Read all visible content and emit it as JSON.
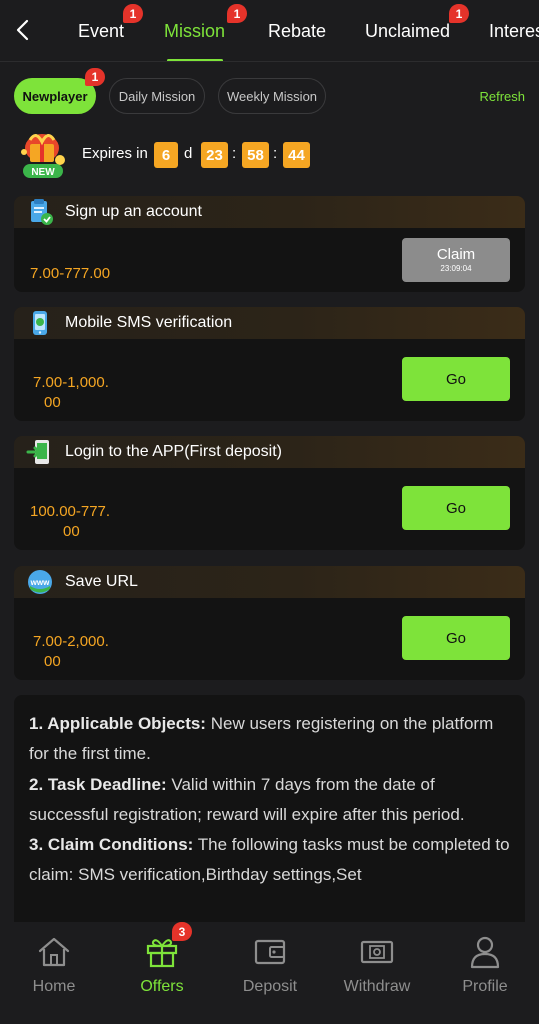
{
  "top_tabs": [
    {
      "label": "Event",
      "badge": "1"
    },
    {
      "label": "Mission",
      "badge": "1",
      "active": true
    },
    {
      "label": "Rebate",
      "badge": ""
    },
    {
      "label": "Unclaimed",
      "badge": "1"
    },
    {
      "label": "Interes",
      "badge": ""
    }
  ],
  "sub_tabs": [
    {
      "label": "Newplayer",
      "badge": "1",
      "active": true
    },
    {
      "label": "Daily Mission"
    },
    {
      "label": "Weekly Mission"
    }
  ],
  "refresh_label": "Refresh",
  "new_badge_text": "NEW",
  "expires": {
    "label": "Expires in",
    "days": "6",
    "days_unit": "d",
    "hours": "23",
    "minutes": "58",
    "seconds": "44",
    "separator": ":"
  },
  "missions": [
    {
      "title": "Sign up an account",
      "icon": "clipboard-check-icon",
      "reward": "7.00-777.00",
      "button": "Claim",
      "button_timer": "23:09:04"
    },
    {
      "title": "Mobile SMS verification",
      "icon": "phone-icon",
      "reward_line1": "7.00-1,000.",
      "reward_line2": "00",
      "button": "Go"
    },
    {
      "title": "Login to the APP(First deposit)",
      "icon": "app-login-icon",
      "reward_line1": "100.00-777.",
      "reward_line2": "00",
      "button": "Go"
    },
    {
      "title": "Save URL",
      "icon": "www-globe-icon",
      "reward_line1": "7.00-2,000.",
      "reward_line2": "00",
      "button": "Go"
    }
  ],
  "rules": [
    {
      "heading": "1. Applicable Objects:",
      "text": " New users registering on the platform for the first time."
    },
    {
      "heading": "2. Task Deadline:",
      "text": " Valid within 7 days from the date of successful registration; reward will expire after this period."
    },
    {
      "heading": "3. Claim Conditions:",
      "text": " The following tasks must be completed to claim: SMS verification,Birthday settings,Set"
    }
  ],
  "bottom_nav": [
    {
      "label": "Home",
      "icon": "home-icon"
    },
    {
      "label": "Offers",
      "icon": "gift-icon",
      "active": true,
      "badge": "3"
    },
    {
      "label": "Deposit",
      "icon": "wallet-icon"
    },
    {
      "label": "Withdraw",
      "icon": "withdraw-icon"
    },
    {
      "label": "Profile",
      "icon": "profile-icon"
    }
  ],
  "colors": {
    "accent": "#7ee33a",
    "background": "#1c1c1e",
    "card": "#131313",
    "reward": "#f5a623",
    "badge": "#e5332a",
    "claim_disabled": "#8c8c8c"
  }
}
